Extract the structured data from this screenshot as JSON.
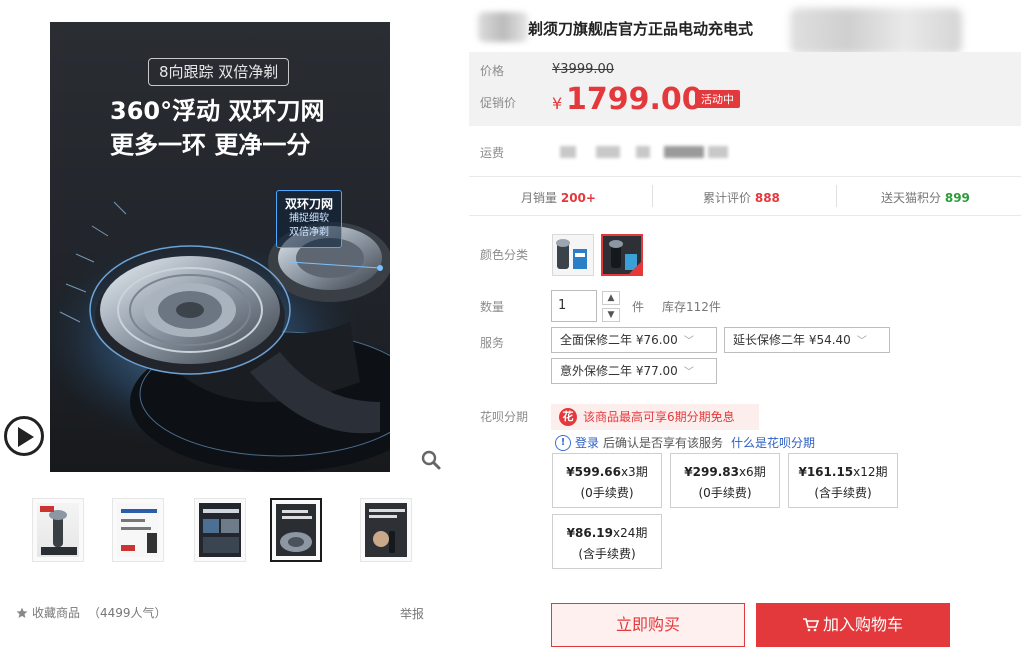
{
  "gallery": {
    "promo_tag": "8向跟踪 双倍净剃",
    "headline_1": "360°浮动 双环刀网",
    "headline_2": "更多一环 更净一分",
    "badge_title": "双环刀网",
    "badge_line_1": "捕捉细软",
    "badge_line_2": "双倍净剃",
    "favorite_label": "收藏商品",
    "favorite_count": "（4499人气）",
    "report_label": "举报"
  },
  "product": {
    "title": "剃须刀旗舰店官方正品电动充电式"
  },
  "price": {
    "list_label": "价格",
    "list_value": "¥3999.00",
    "promo_label": "促销价",
    "currency": "¥",
    "promo_value": "1799.00",
    "promo_tag": "活动中",
    "shipping_label": "运费"
  },
  "stats": {
    "monthly_label": "月销量",
    "monthly_value": "200+",
    "reviews_label": "累计评价",
    "reviews_value": "888",
    "points_label": "送天猫积分",
    "points_value": "899"
  },
  "options": {
    "color_label": "颜色分类",
    "qty_label": "数量",
    "qty_value": "1",
    "qty_unit": "件",
    "stock": "库存112件",
    "service_label": "服务",
    "services": [
      "全面保修二年 ¥76.00",
      "延长保修二年 ¥54.40",
      "意外保修二年 ¥77.00"
    ]
  },
  "huabei": {
    "label": "花呗分期",
    "banner": "该商品最高可享6期分期免息",
    "login": "登录",
    "confirm": "后确认是否享有该服务",
    "what": "什么是花呗分期",
    "plans": [
      {
        "amount": "¥599.66",
        "period": "x3期",
        "fee": "(0手续费)"
      },
      {
        "amount": "¥299.83",
        "period": "x6期",
        "fee": "(0手续费)"
      },
      {
        "amount": "¥161.15",
        "period": "x12期",
        "fee": "(含手续费)"
      },
      {
        "amount": "¥86.19",
        "period": "x24期",
        "fee": "(含手续费)"
      }
    ]
  },
  "actions": {
    "buy_now": "立即购买",
    "add_cart": "加入购物车"
  },
  "colors": {
    "accent": "#e4393c",
    "points_green": "#2a9d3a",
    "link_blue": "#2d5fc4"
  }
}
